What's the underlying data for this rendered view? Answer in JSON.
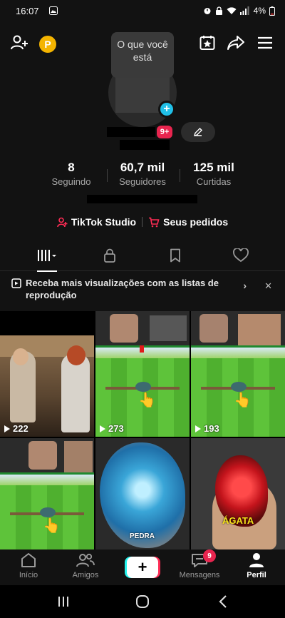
{
  "status_bar": {
    "time": "16:07",
    "battery": "4%"
  },
  "header": {
    "coin_label": "P",
    "tooltip_text": "O que você está",
    "notification_count": "9+"
  },
  "stats": [
    {
      "value": "8",
      "label": "Seguindo"
    },
    {
      "value": "60,7 mil",
      "label": "Seguidores"
    },
    {
      "value": "125 mil",
      "label": "Curtidas"
    }
  ],
  "links": {
    "studio": "TikTok Studio",
    "orders": "Seus pedidos"
  },
  "banner": {
    "text": "Receba mais visualizações com as listas de reprodução"
  },
  "videos": [
    {
      "views": "222",
      "theme": "kitchen"
    },
    {
      "views": "273",
      "theme": "game"
    },
    {
      "views": "193",
      "theme": "game"
    },
    {
      "views": "",
      "theme": "game"
    },
    {
      "views": "",
      "theme": "geode",
      "caption": "PEDRA"
    },
    {
      "views": "",
      "theme": "agate",
      "caption": "ÁGATA"
    }
  ],
  "bottom_nav": {
    "home": "Início",
    "friends": "Amigos",
    "messages": "Mensagens",
    "messages_badge": "9",
    "profile": "Perfil"
  },
  "colors": {
    "background": "#121212",
    "accent_red": "#fe2c55",
    "accent_cyan": "#25f4ee",
    "coin": "#f4b400"
  }
}
